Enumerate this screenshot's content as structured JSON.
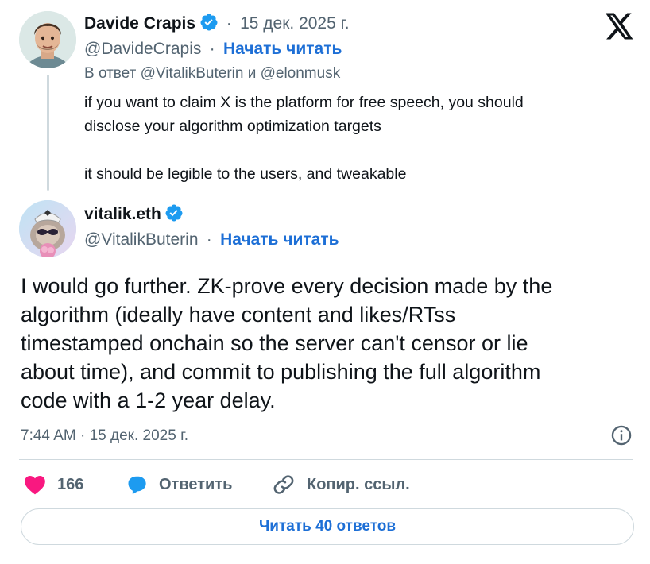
{
  "parent_tweet": {
    "author_name": "Davide Crapis",
    "date": "15 дек. 2025 г.",
    "handle": "@DavideCrapis",
    "follow_label": "Начать читать",
    "reply_to": "В ответ @VitalikButerin и @elonmusk",
    "text_line1": "if you want to claim X is the platform for free speech, you should",
    "text_line2": "disclose your algorithm optimization targets",
    "text_line3": "it should be legible to the users, and tweakable"
  },
  "main_tweet": {
    "author_name": "vitalik.eth",
    "handle": "@VitalikButerin",
    "follow_label": "Начать читать",
    "text_lines": [
      "I would go further. ZK-prove every decision made by the",
      "algorithm (ideally have content and likes/RTss",
      "timestamped onchain so the server can't censor or lie",
      "about time), and commit to publishing the full algorithm",
      "code with a 1-2 year delay."
    ],
    "timestamp": "7:44 AM · 15 дек. 2025 г."
  },
  "separator": "·",
  "actions": {
    "likes_count": "166",
    "reply_label": "Ответить",
    "copy_link_label": "Копир. ссыл."
  },
  "read_replies_label": "Читать 40 ответов",
  "colors": {
    "accent": "#1d9bf0",
    "link": "#1d6fd6",
    "heart": "#f91880",
    "muted": "#536471",
    "border": "#cfd9de"
  },
  "icons": [
    "x-logo-icon",
    "verified-badge-icon",
    "heart-icon",
    "reply-bubble-icon",
    "link-icon",
    "info-icon"
  ]
}
